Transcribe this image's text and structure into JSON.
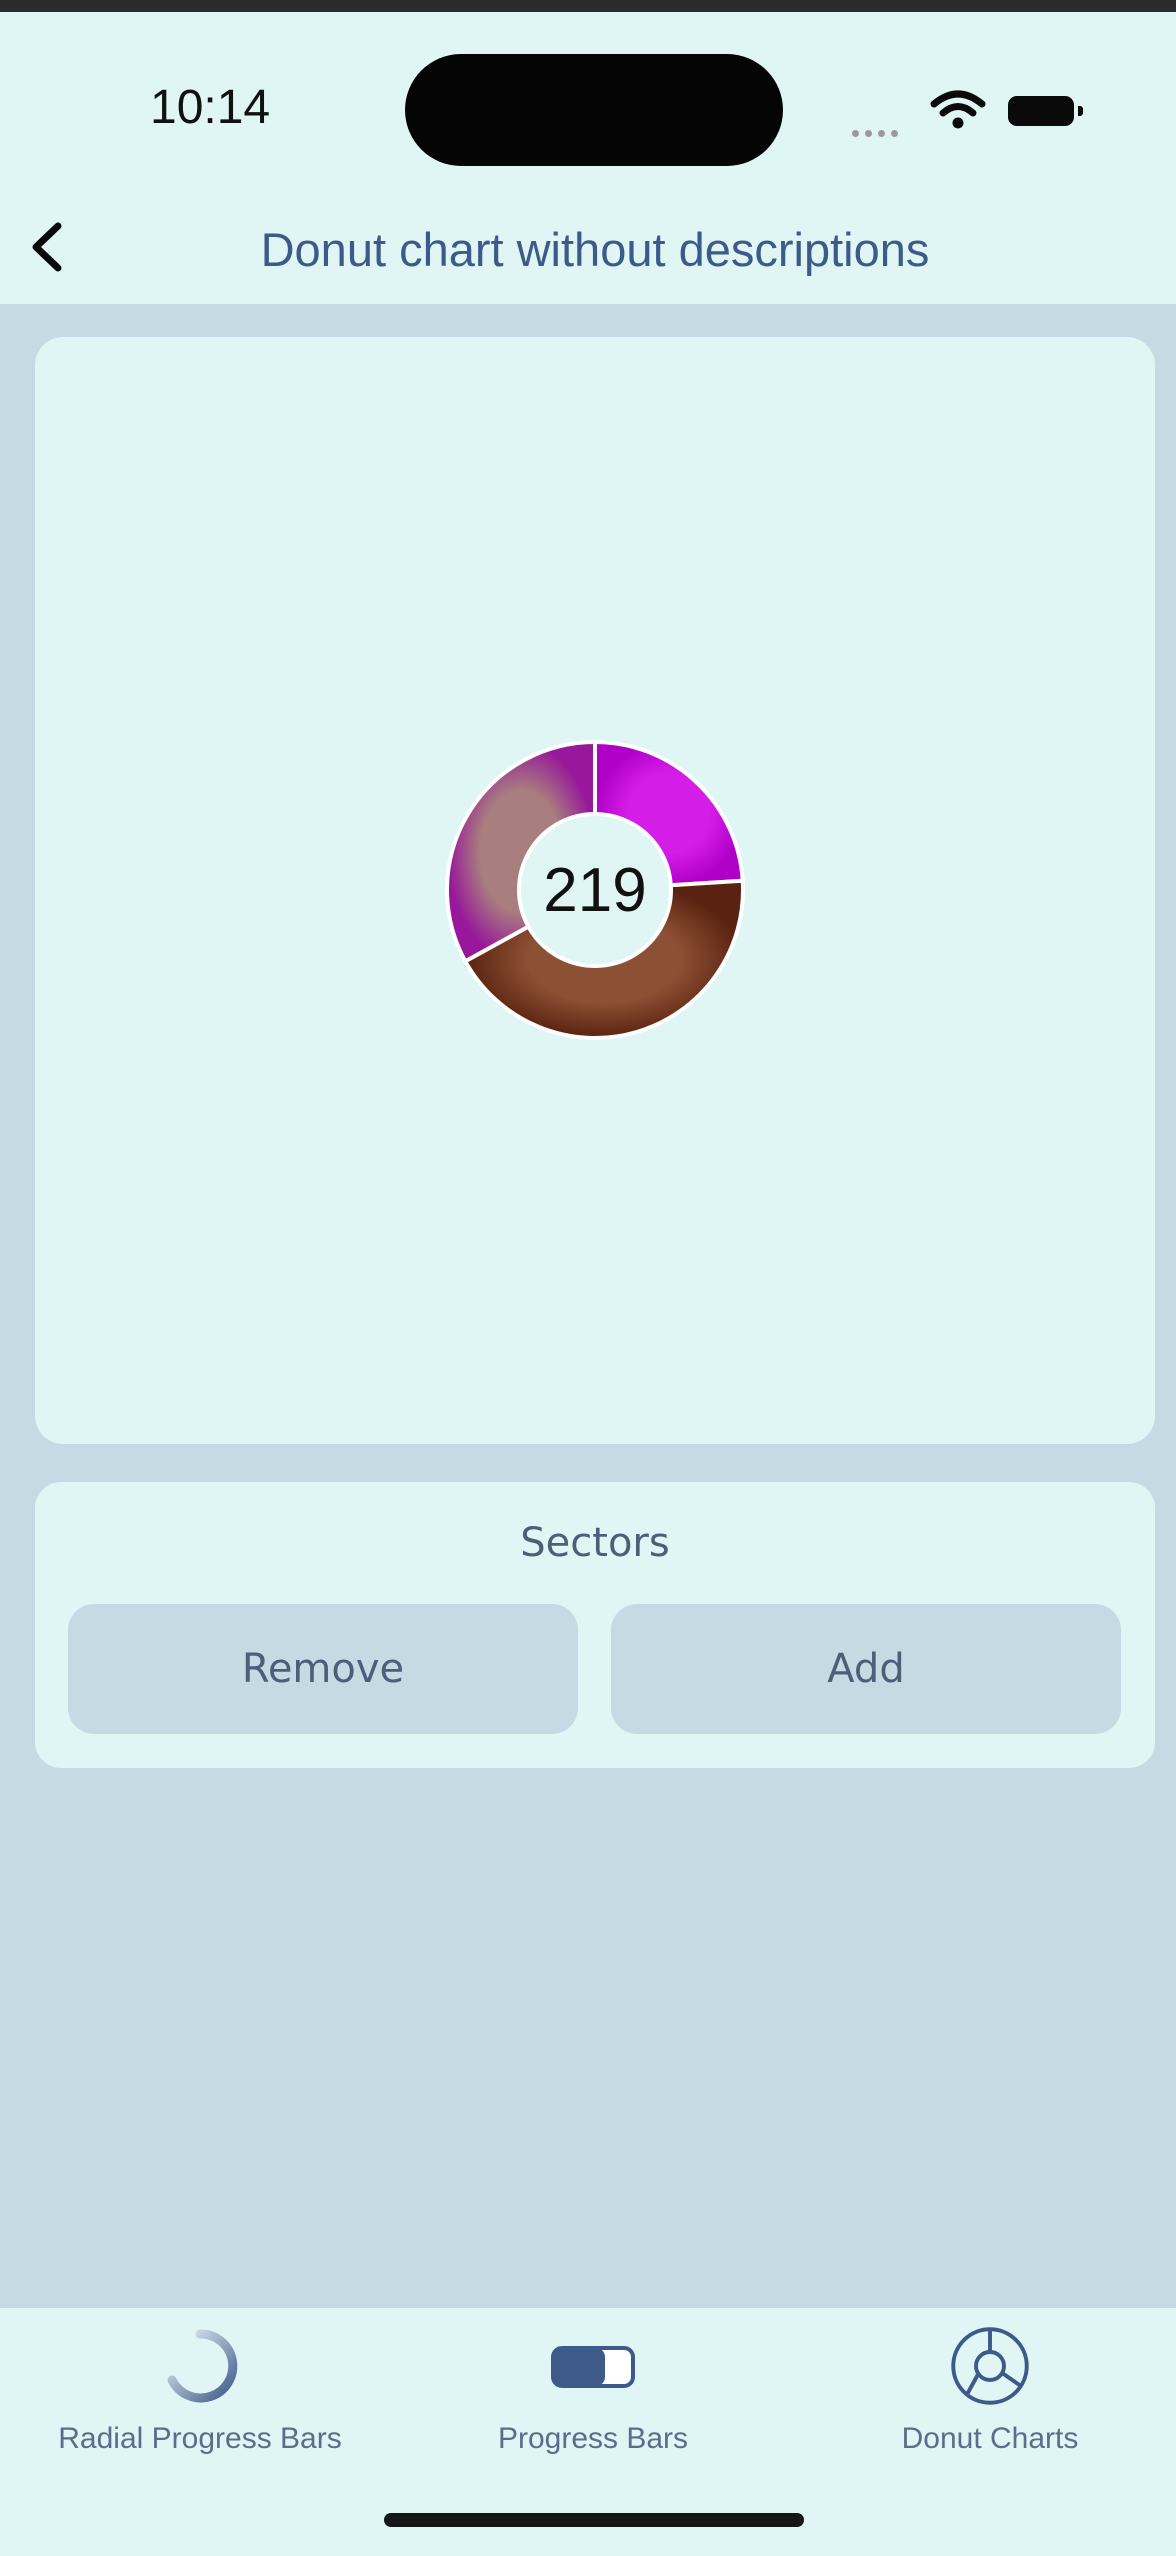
{
  "status_bar": {
    "time": "10:14"
  },
  "header": {
    "title": "Donut chart without descriptions"
  },
  "chart_data": {
    "type": "pie",
    "center_label": "219",
    "segments": [
      {
        "fraction": 0.24,
        "color_start": "#c71fe0",
        "color_end": "#b000c8"
      },
      {
        "fraction": 0.43,
        "color_start": "#8a4a30",
        "color_end": "#5a2210"
      },
      {
        "fraction": 0.33,
        "color_start": "#a55fa0",
        "color_end": "#95207f"
      }
    ]
  },
  "controls": {
    "sectors_label": "Sectors",
    "remove_label": "Remove",
    "add_label": "Add"
  },
  "tabbar": {
    "items": [
      {
        "label": "Radial Progress Bars",
        "icon": "radial-progress-icon"
      },
      {
        "label": "Progress Bars",
        "icon": "progress-bar-icon"
      },
      {
        "label": "Donut Charts",
        "icon": "donut-chart-icon"
      }
    ]
  },
  "colors": {
    "background": "#c4dbe3",
    "card": "#dff6f4",
    "accent_text": "#3e5a8a"
  }
}
